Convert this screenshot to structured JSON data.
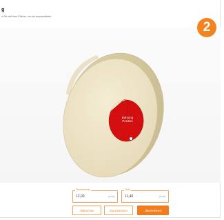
{
  "header": {
    "title": "g",
    "subtitle": "n Sie auf eine Fläche, um sie auszuwählen."
  },
  "badge": {
    "number": "2",
    "color": "#f18420"
  },
  "model": {
    "hole_label_line1": "Bohrung",
    "hole_label_line2": "Position",
    "body_color": "#ede3c6",
    "selected_color": "#d40f0f"
  },
  "fields": {
    "diameter": {
      "label": "Durchmesser",
      "value": "12,00",
      "unit": "(mm)"
    },
    "depth": {
      "label": "Tiefe",
      "value": "11,40",
      "unit": "(mm)"
    }
  },
  "buttons": {
    "cancel": "Abbrechen",
    "reset": "Zurücksetzen",
    "apply": "Übernehmen"
  }
}
